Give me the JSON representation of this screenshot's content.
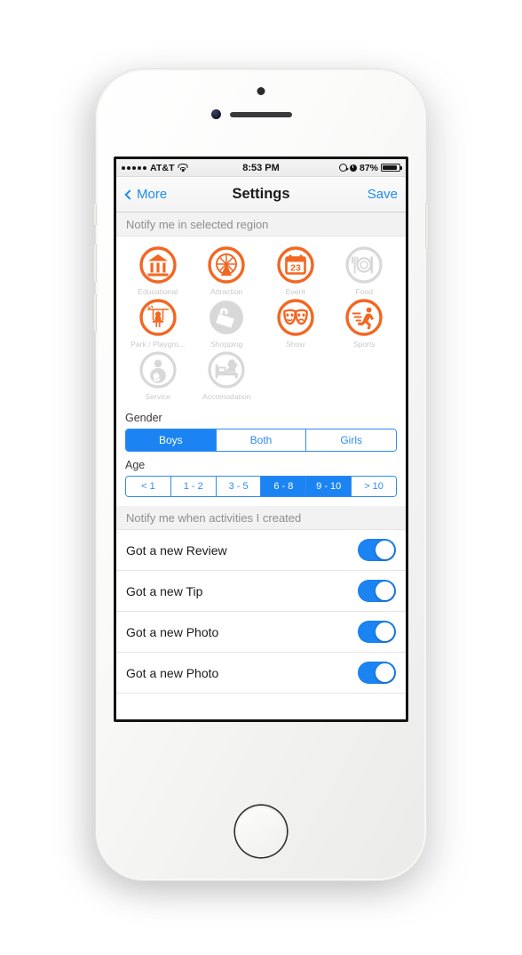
{
  "statusbar": {
    "signal_dots": 5,
    "carrier": "AT&T",
    "wifi_icon": "wifi-icon",
    "time": "8:53 PM",
    "location_icon": "location-arrow-icon",
    "alarm_icon": "alarm-clock-icon",
    "battery_percent": "87%",
    "battery_level": 87
  },
  "navbar": {
    "back_label": "More",
    "back_icon": "chevron-left-icon",
    "title": "Settings",
    "save_label": "Save"
  },
  "sections": {
    "region_header": "Notify me in selected region",
    "activities_header": "Notify me when activities I created"
  },
  "categories": [
    {
      "label": "Educational",
      "icon": "bank-columns-icon",
      "selected": true
    },
    {
      "label": "Attraction",
      "icon": "ferris-wheel-icon",
      "selected": true
    },
    {
      "label": "Event",
      "icon": "calendar-23-icon",
      "selected": true,
      "calendar_day": "23"
    },
    {
      "label": "Food",
      "icon": "plate-cutlery-icon",
      "selected": false
    },
    {
      "label": "Park / Playgro...",
      "icon": "swing-child-icon",
      "selected": true
    },
    {
      "label": "Shopping",
      "icon": "shopping-bag-icon",
      "selected": false
    },
    {
      "label": "Show",
      "icon": "theater-masks-icon",
      "selected": true
    },
    {
      "label": "Sports",
      "icon": "running-person-icon",
      "selected": true
    },
    {
      "label": "Service",
      "icon": "baby-care-icon",
      "selected": false
    },
    {
      "label": "Accomodation",
      "icon": "bed-moon-icon",
      "selected": false
    }
  ],
  "gender": {
    "label": "Gender",
    "options": [
      {
        "label": "Boys",
        "selected": true
      },
      {
        "label": "Both",
        "selected": false
      },
      {
        "label": "Girls",
        "selected": false
      }
    ]
  },
  "age": {
    "label": "Age",
    "options": [
      {
        "label": "< 1",
        "selected": false
      },
      {
        "label": "1 - 2",
        "selected": false
      },
      {
        "label": "3 - 5",
        "selected": false
      },
      {
        "label": "6 - 8",
        "selected": true
      },
      {
        "label": "9 - 10",
        "selected": true
      },
      {
        "label": "> 10",
        "selected": false
      }
    ]
  },
  "activity_toggles": [
    {
      "label": "Got a new Review",
      "on": true
    },
    {
      "label": "Got a new Tip",
      "on": true
    },
    {
      "label": "Got a new Photo",
      "on": true
    },
    {
      "label": "Got a new Photo",
      "on": true
    }
  ],
  "colors": {
    "accent_orange": "#F26722",
    "inactive_gray": "#D8D8D8",
    "accent_blue": "#1B84F2",
    "label_gray": "#C9C9C9"
  }
}
